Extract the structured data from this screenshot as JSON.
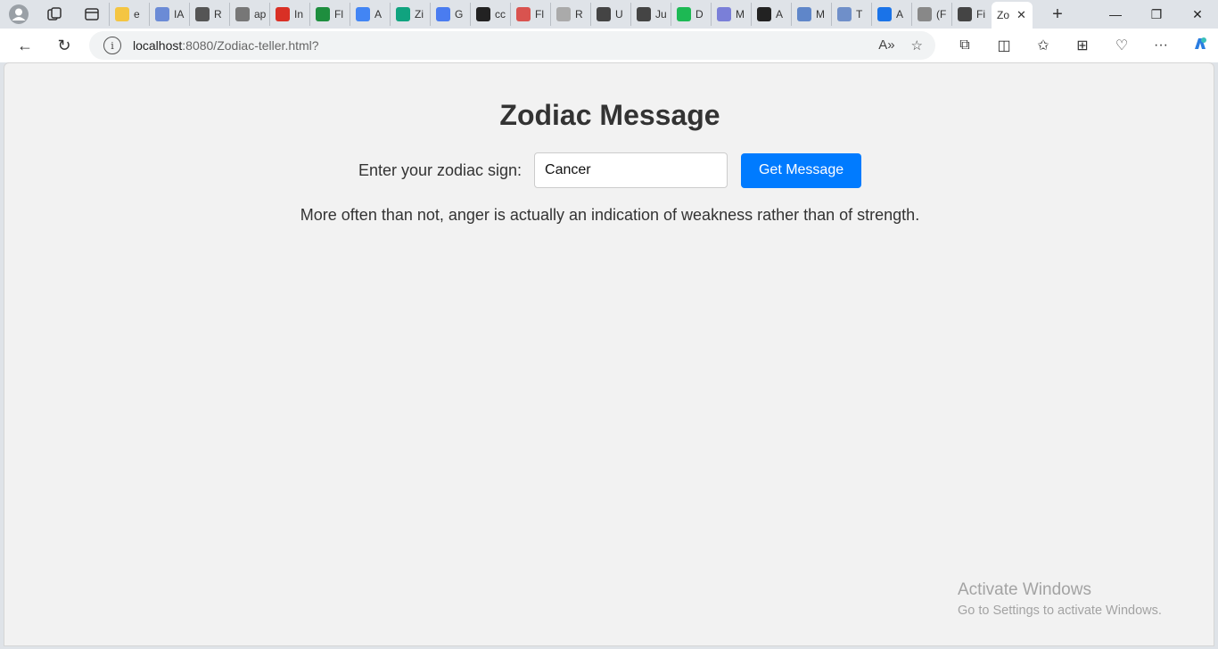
{
  "tabs": [
    {
      "letter": "e",
      "color": "#f4c542",
      "icon": "folder-icon"
    },
    {
      "letter": "IA",
      "color": "#6b8bd6",
      "icon": "shield-icon"
    },
    {
      "letter": "R",
      "color": "#555555",
      "icon": "link-icon"
    },
    {
      "letter": "ap",
      "color": "#777777",
      "icon": "document-icon"
    },
    {
      "letter": "In",
      "color": "#d93025",
      "icon": "gmail-icon"
    },
    {
      "letter": "Fl",
      "color": "#1e8e3e",
      "icon": "plus-icon"
    },
    {
      "letter": "A",
      "color": "#4285f4",
      "icon": "docs-icon"
    },
    {
      "letter": "Zi",
      "color": "#10a37f",
      "icon": "chatgpt-icon"
    },
    {
      "letter": "G",
      "color": "#4a7cf0",
      "icon": "gemini-icon"
    },
    {
      "letter": "cc",
      "color": "#222222",
      "icon": "lock-doc-icon"
    },
    {
      "letter": "Fl",
      "color": "#d9534f",
      "icon": "pdf-icon"
    },
    {
      "letter": "R",
      "color": "#aaaaaa",
      "icon": "globe-icon"
    },
    {
      "letter": "U",
      "color": "#444444",
      "icon": "profile-icon"
    },
    {
      "letter": "Ju",
      "color": "#444444",
      "icon": "profile-icon"
    },
    {
      "letter": "D",
      "color": "#1db954",
      "icon": "spotify-icon"
    },
    {
      "letter": "M",
      "color": "#7a7fd8",
      "icon": "hexagon-icon"
    },
    {
      "letter": "A",
      "color": "#222222",
      "icon": "github-icon"
    },
    {
      "letter": "M",
      "color": "#5f86c9",
      "icon": "search-icon"
    },
    {
      "letter": "T",
      "color": "#6f8fc9",
      "icon": "globe-icon"
    },
    {
      "letter": "A",
      "color": "#1a73e8",
      "icon": "search-icon"
    },
    {
      "letter": "(F",
      "color": "#888888",
      "icon": "r-icon"
    },
    {
      "letter": "Fi",
      "color": "#444444",
      "icon": "image-icon"
    }
  ],
  "active_tab": {
    "letter": "Zo"
  },
  "address": {
    "host": "localhost",
    "rest": ":8080/Zodiac-teller.html?"
  },
  "page": {
    "title": "Zodiac Message",
    "label": "Enter your zodiac sign:",
    "input_value": "Cancer",
    "button_label": "Get Message",
    "message": "More often than not, anger is actually an indication of weakness rather than of strength."
  },
  "watermark": {
    "line1": "Activate Windows",
    "line2": "Go to Settings to activate Windows."
  },
  "colors": {
    "accent": "#007bff",
    "page_bg": "#f2f2f2"
  }
}
